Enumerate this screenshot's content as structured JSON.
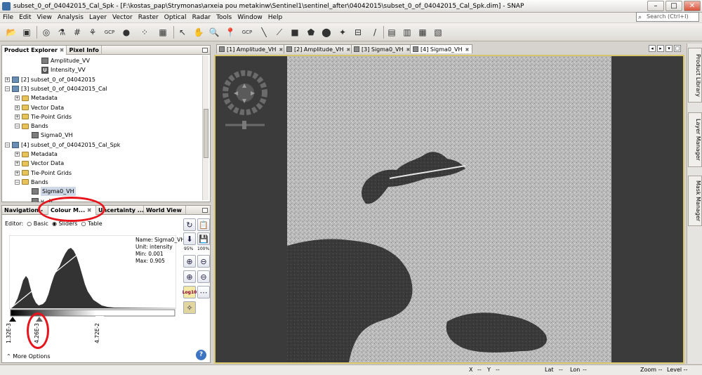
{
  "window": {
    "title": "subset_0_of_04042015_Cal_Spk - [F:\\kostas_pap\\Strymonas\\arxeia pou metakinw\\Sentinel1\\sentinel_after\\04042015\\subset_0_of_04042015_Cal_Spk.dim] - SNAP",
    "minimize": "–",
    "maximize": "□",
    "close": "✕"
  },
  "menu": [
    "File",
    "Edit",
    "View",
    "Analysis",
    "Layer",
    "Vector",
    "Raster",
    "Optical",
    "Radar",
    "Tools",
    "Window",
    "Help"
  ],
  "search": {
    "placeholder": "Search (Ctrl+I)"
  },
  "toolbar": {
    "gcp1": "GCP",
    "gcp2": "GCP"
  },
  "product_explorer": {
    "tabs": [
      "Product Explorer",
      "Pixel Info"
    ],
    "tree": [
      {
        "indent": 3,
        "icon": "band",
        "label": "Amplitude_VV",
        "exp": ""
      },
      {
        "indent": 3,
        "icon": "u",
        "label": "Intensity_VV",
        "exp": ""
      },
      {
        "indent": 0,
        "icon": "prod",
        "label": "[2] subset_0_of_04042015",
        "exp": "+"
      },
      {
        "indent": 0,
        "icon": "prod",
        "label": "[3] subset_0_of_04042015_Cal",
        "exp": "−"
      },
      {
        "indent": 1,
        "icon": "folder",
        "label": "Metadata",
        "exp": "+"
      },
      {
        "indent": 1,
        "icon": "folder",
        "label": "Vector Data",
        "exp": "+"
      },
      {
        "indent": 1,
        "icon": "folder",
        "label": "Tie-Point Grids",
        "exp": "+"
      },
      {
        "indent": 1,
        "icon": "folder",
        "label": "Bands",
        "exp": "−"
      },
      {
        "indent": 2,
        "icon": "band",
        "label": "Sigma0_VH",
        "exp": ""
      },
      {
        "indent": 0,
        "icon": "prod",
        "label": "[4] subset_0_of_04042015_Cal_Spk",
        "exp": "−"
      },
      {
        "indent": 1,
        "icon": "folder",
        "label": "Metadata",
        "exp": "+"
      },
      {
        "indent": 1,
        "icon": "folder",
        "label": "Vector Data",
        "exp": "+"
      },
      {
        "indent": 1,
        "icon": "folder",
        "label": "Tie-Point Grids",
        "exp": "+"
      },
      {
        "indent": 1,
        "icon": "folder",
        "label": "Bands",
        "exp": "−"
      },
      {
        "indent": 2,
        "icon": "band",
        "label": "Sigma0_VH",
        "exp": "",
        "selected": true
      },
      {
        "indent": 2,
        "icon": "band",
        "label": "v...h",
        "exp": ""
      }
    ]
  },
  "tool_panel": {
    "tabs": [
      "Navigation -",
      "Colour M...",
      "Uncertainty ...",
      "World View"
    ],
    "editor_label": "Editor:",
    "editor_options": [
      "Basic",
      "Sliders",
      "Table"
    ],
    "editor_selected": "Sliders",
    "info": {
      "name": "Name: Sigma0_VH",
      "unit": "Unit: intensity",
      "min": "Min: 0.001",
      "max": "Max: 0.905"
    },
    "slider_labels": [
      "1.32E-3",
      "4.26E-3",
      "4.72E-2"
    ],
    "more_options": "More Options",
    "zoom_95": "95%",
    "zoom_100": "100%",
    "log_label": "Log10",
    "help": "?"
  },
  "image_tabs": [
    "[1] Amplitude_VH",
    "[2] Amplitude_VH",
    "[3] Sigma0_VH",
    "[4] Sigma0_VH"
  ],
  "active_image_tab": 3,
  "right_sidebar": [
    "Product Library",
    "Layer Manager",
    "Mask Manager"
  ],
  "status": {
    "x": "X",
    "x_val": "--",
    "y": "Y",
    "y_val": "--",
    "lat": "Lat",
    "lat_val": "--",
    "lon": "Lon",
    "lon_val": "--",
    "zoom": "Zoom --",
    "level": "Level --"
  },
  "colors": {
    "annotation_red": "#e8141c",
    "panel_bg": "#d6d3ce",
    "image_border": "#d6c56a"
  }
}
